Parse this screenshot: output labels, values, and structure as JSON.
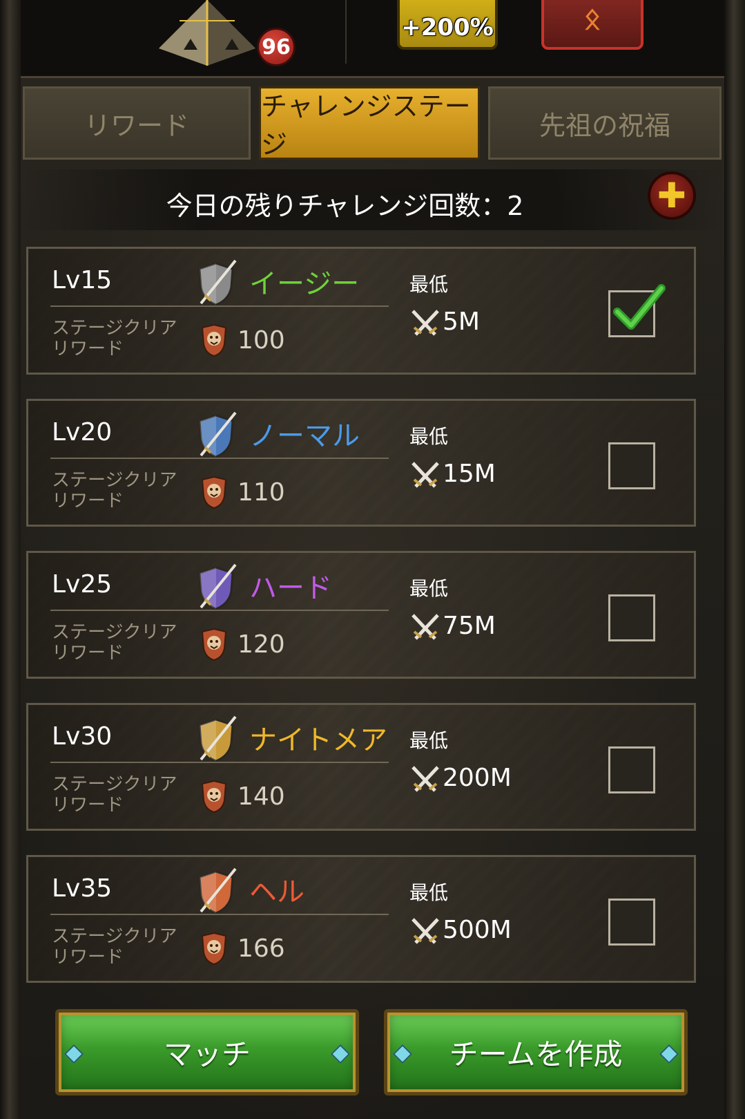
{
  "top": {
    "level_badge": "96",
    "boost_label": "+200%",
    "rune_symbol": "ᛟ"
  },
  "tabs": [
    {
      "label": "リワード",
      "active": false
    },
    {
      "label": "チャレンジステージ",
      "active": true
    },
    {
      "label": "先祖の祝福",
      "active": false
    }
  ],
  "remaining": {
    "text": "今日の残りチャレンジ回数：2"
  },
  "stages": [
    {
      "lv": "Lv15",
      "difficulty": "イージー",
      "difficulty_color": "#6fd23a",
      "shield_color": "#8a8a8a",
      "clear_label_1": "ステージクリア",
      "clear_label_2": "リワード",
      "reward": "100",
      "min_label": "最低",
      "power": "5M",
      "checked": true
    },
    {
      "lv": "Lv20",
      "difficulty": "ノーマル",
      "difficulty_color": "#4b9be8",
      "shield_color": "#4a78b8",
      "clear_label_1": "ステージクリア",
      "clear_label_2": "リワード",
      "reward": "110",
      "min_label": "最低",
      "power": "15M",
      "checked": false
    },
    {
      "lv": "Lv25",
      "difficulty": "ハード",
      "difficulty_color": "#c25ae8",
      "shield_color": "#6f5ab8",
      "clear_label_1": "ステージクリア",
      "clear_label_2": "リワード",
      "reward": "120",
      "min_label": "最低",
      "power": "75M",
      "checked": false
    },
    {
      "lv": "Lv30",
      "difficulty": "ナイトメア",
      "difficulty_color": "#f0b82a",
      "shield_color": "#c89a3a",
      "clear_label_1": "ステージクリア",
      "clear_label_2": "リワード",
      "reward": "140",
      "min_label": "最低",
      "power": "200M",
      "checked": false
    },
    {
      "lv": "Lv35",
      "difficulty": "ヘル",
      "difficulty_color": "#ee5a34",
      "shield_color": "#d0683a",
      "clear_label_1": "ステージクリア",
      "clear_label_2": "リワード",
      "reward": "166",
      "min_label": "最低",
      "power": "500M",
      "checked": false
    }
  ],
  "buttons": {
    "match": "マッチ",
    "create_team": "チームを作成"
  }
}
